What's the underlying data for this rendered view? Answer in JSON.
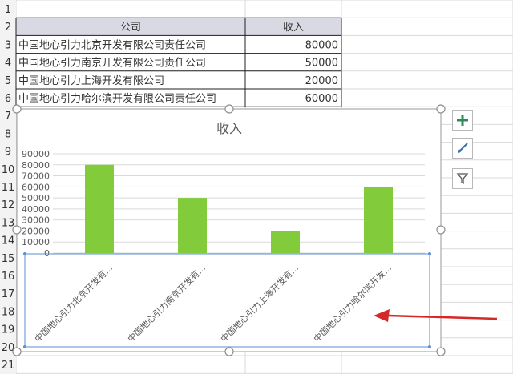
{
  "sheet": {
    "row_numbers": [
      "1",
      "2",
      "3",
      "4",
      "5",
      "6",
      "7",
      "8",
      "9",
      "10",
      "11",
      "12",
      "13",
      "14",
      "15",
      "16",
      "17",
      "18",
      "19",
      "20",
      "21"
    ],
    "table": {
      "headers": [
        "公司",
        "收入"
      ],
      "rows": [
        [
          "中国地心引力北京开发有限公司责任公司",
          "80000"
        ],
        [
          "中国地心引力南京开发有限公司责任公司",
          "50000"
        ],
        [
          "中国地心引力上海开发有限公司",
          "20000"
        ],
        [
          "中国地心引力哈尔滨开发有限公司责任公司",
          "60000"
        ]
      ]
    }
  },
  "chart_data": {
    "type": "bar",
    "title": "收入",
    "categories": [
      "中国地心引力北京开发有...",
      "中国地心引力南京开发有...",
      "中国地心引力上海开发有...",
      "中国地心引力哈尔滨开发..."
    ],
    "values": [
      80000,
      50000,
      20000,
      60000
    ],
    "y_ticks": [
      "90000",
      "80000",
      "70000",
      "60000",
      "50000",
      "40000",
      "30000",
      "20000",
      "10000",
      "0"
    ],
    "ylim": [
      0,
      90000
    ],
    "grid": true,
    "legend": "none"
  },
  "colors": {
    "bar": "#82cc3c",
    "header_fill": "#d9d9e3",
    "arrow": "#d62828",
    "tool_plus": "#2e8b57",
    "tool_brush": "#3a6fb0"
  },
  "tools": [
    {
      "name": "chart-elements-button",
      "icon": "plus-icon"
    },
    {
      "name": "chart-styles-button",
      "icon": "paintbrush-icon"
    },
    {
      "name": "chart-filters-button",
      "icon": "filter-icon"
    }
  ]
}
